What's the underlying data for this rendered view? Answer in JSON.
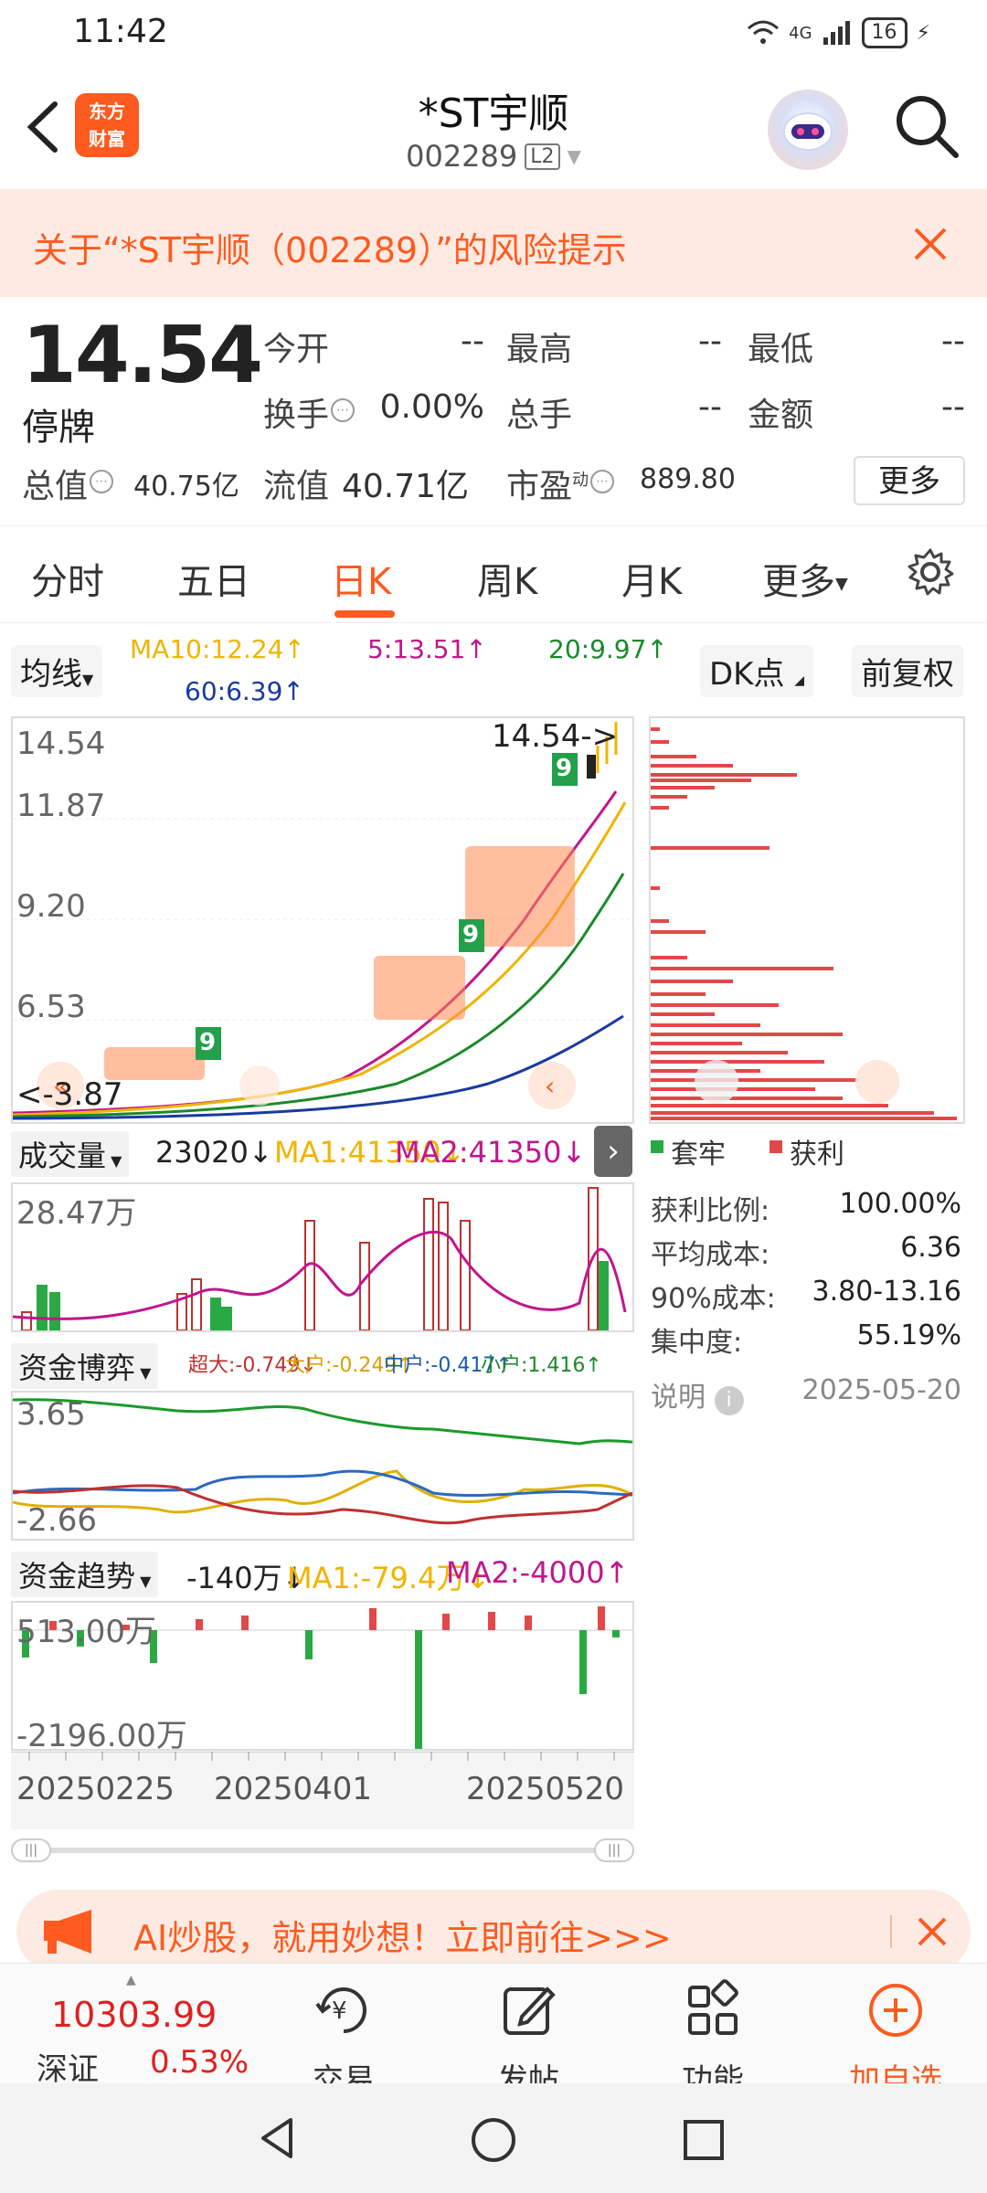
{
  "status_bar": {
    "time": "11:42",
    "network": "4G",
    "battery": "16"
  },
  "header": {
    "stock_name": "*ST宇顺",
    "stock_code": "002289",
    "level_badge": "L2",
    "logo_line1": "东方",
    "logo_line2": "财富"
  },
  "risk_banner": {
    "text": "关于“*ST宇顺（002289）”的风险提示"
  },
  "quote": {
    "price": "14.54",
    "status": "停牌",
    "open_label": "今开",
    "open_value": "--",
    "high_label": "最高",
    "high_value": "--",
    "low_label": "最低",
    "low_value": "--",
    "turnover_label": "换手",
    "turnover_value": "0.00%",
    "volume_label": "总手",
    "volume_value": "--",
    "amount_label": "金额",
    "amount_value": "--",
    "market_cap_label": "总值",
    "market_cap_value": "40.75亿",
    "float_cap_label": "流值",
    "float_cap_value": "40.71亿",
    "pe_label": "市盈",
    "pe_superscript": "动",
    "pe_value": "889.80",
    "more_label": "更多"
  },
  "tabs": [
    "分时",
    "五日",
    "日K",
    "周K",
    "月K",
    "更多"
  ],
  "active_tab": "日K",
  "kline": {
    "indicator_select": "均线",
    "ma10": "MA10:12.24↑",
    "ma5": "5:13.51↑",
    "ma20": "20:9.97↑",
    "ma60": "60:6.39↑",
    "dk_select": "DK点",
    "adjust_select": "前复权",
    "y_labels": [
      "14.54",
      "11.87",
      "9.20",
      "6.53"
    ],
    "price_marker": "14.54->",
    "low_marker": "<-3.87",
    "td_labels": [
      "9",
      "9",
      "9"
    ]
  },
  "volume_panel": {
    "select": "成交量",
    "value": "23020↓",
    "ma1": "MA1:41350↓",
    "ma2": "MA2:41350↓",
    "y_label": "28.47万"
  },
  "fund_game_panel": {
    "select": "资金博弈",
    "super_large": "超大:-0.749↓",
    "large": "大户:-0.249↑",
    "medium": "中户:-0.417↑",
    "small": "小户:1.416↑",
    "y_top": "3.65",
    "y_bottom": "-2.66"
  },
  "fund_trend_panel": {
    "select": "资金趋势",
    "value": "-140万↓",
    "ma1": "MA1:-79.4万↓",
    "ma2": "MA2:-4000↑",
    "y_top": "513.00万",
    "y_bottom": "-2196.00万"
  },
  "x_axis": [
    "20250225",
    "20250401",
    "20250520"
  ],
  "chip_distribution": {
    "legend_trapped": "套牢",
    "legend_profit": "获利",
    "stats": [
      {
        "label": "获利比例:",
        "value": "100.00%"
      },
      {
        "label": "平均成本:",
        "value": "6.36"
      },
      {
        "label": "90%成本:",
        "value": "3.80-13.16"
      },
      {
        "label": "集中度:",
        "value": "55.19%"
      }
    ],
    "note_label": "说明",
    "date": "2025-05-20"
  },
  "ai_banner": {
    "text": "AI炒股，就用妙想！立即前往>>>"
  },
  "bottom_nav": {
    "index_value": "10303.99",
    "index_name": "深证",
    "index_change": "0.53%",
    "items": [
      "交易",
      "发帖",
      "功能",
      "加自选"
    ]
  },
  "colors": {
    "accent": "#ff5a1f",
    "up": "#e02020",
    "down": "#1a9f2a",
    "ma5": "#c0168e",
    "ma10": "#f0b400",
    "ma20": "#1a8a2a",
    "ma60": "#1a3aa0"
  }
}
